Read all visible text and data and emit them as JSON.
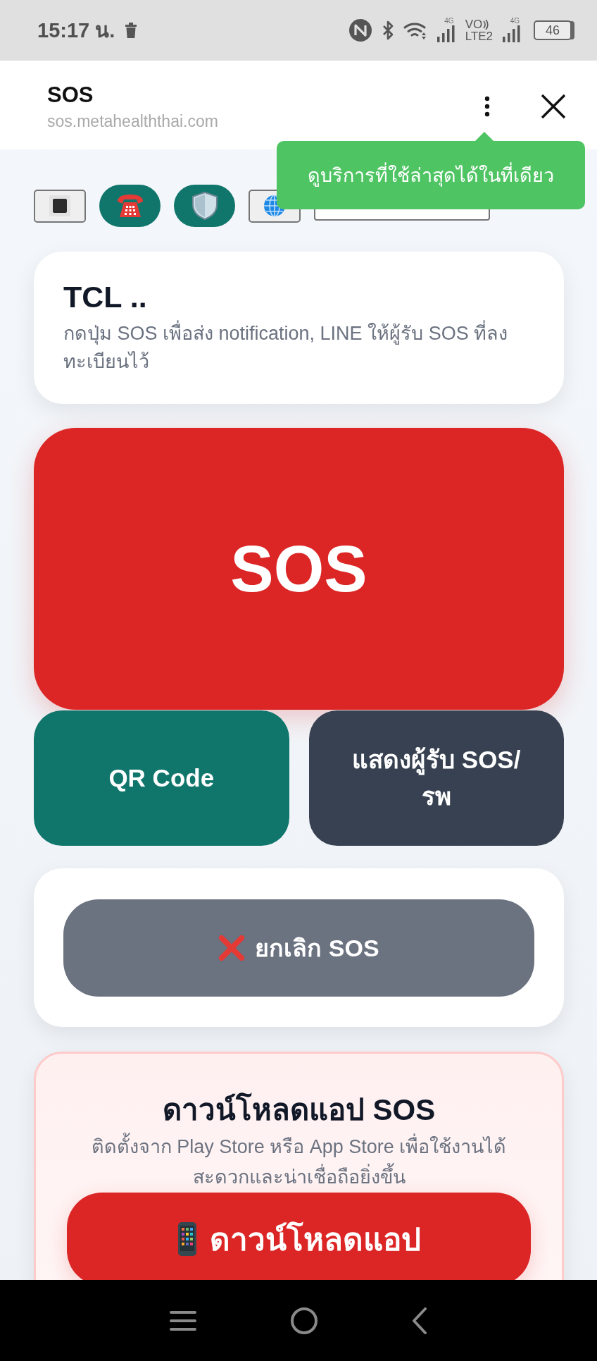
{
  "status_bar": {
    "time": "15:17 น.",
    "sim1_network": "4G",
    "volte_top": "VO",
    "volte_bottom": "LTE2",
    "sim2_network": "4G",
    "battery": "46"
  },
  "browser_bar": {
    "title": "SOS",
    "url": "sos.metahealththai.com"
  },
  "tooltip": {
    "text": "ดูบริการที่ใช้ล่าสุดได้ในที่เดียว"
  },
  "toolbar": {
    "buttons": [
      {
        "kind": "plain"
      },
      {
        "kind": "pill"
      },
      {
        "kind": "pill"
      },
      {
        "kind": "plain"
      }
    ]
  },
  "profile_card": {
    "title": "TCL ..",
    "description": "กดปุ่ม SOS เพื่อส่ง notification, LINE ให้ผู้รับ SOS ที่ลงทะเบียนไว้"
  },
  "sos_button": {
    "label": "SOS"
  },
  "action_buttons": [
    {
      "kind": "primary",
      "label": "QR Code"
    },
    {
      "kind": "secondary",
      "label": "แสดงผู้รับ SOS/รพ"
    }
  ],
  "cancel_card": {
    "button": "ยกเลิก SOS"
  },
  "download_card": {
    "title": "ดาวน์โหลดแอป SOS",
    "description": "ติดตั้งจาก Play Store หรือ App Store เพื่อใช้งานได้สะดวกและน่าเชื่อถือยิ่งขึ้น",
    "button": "ดาวน์โหลดแอป"
  }
}
